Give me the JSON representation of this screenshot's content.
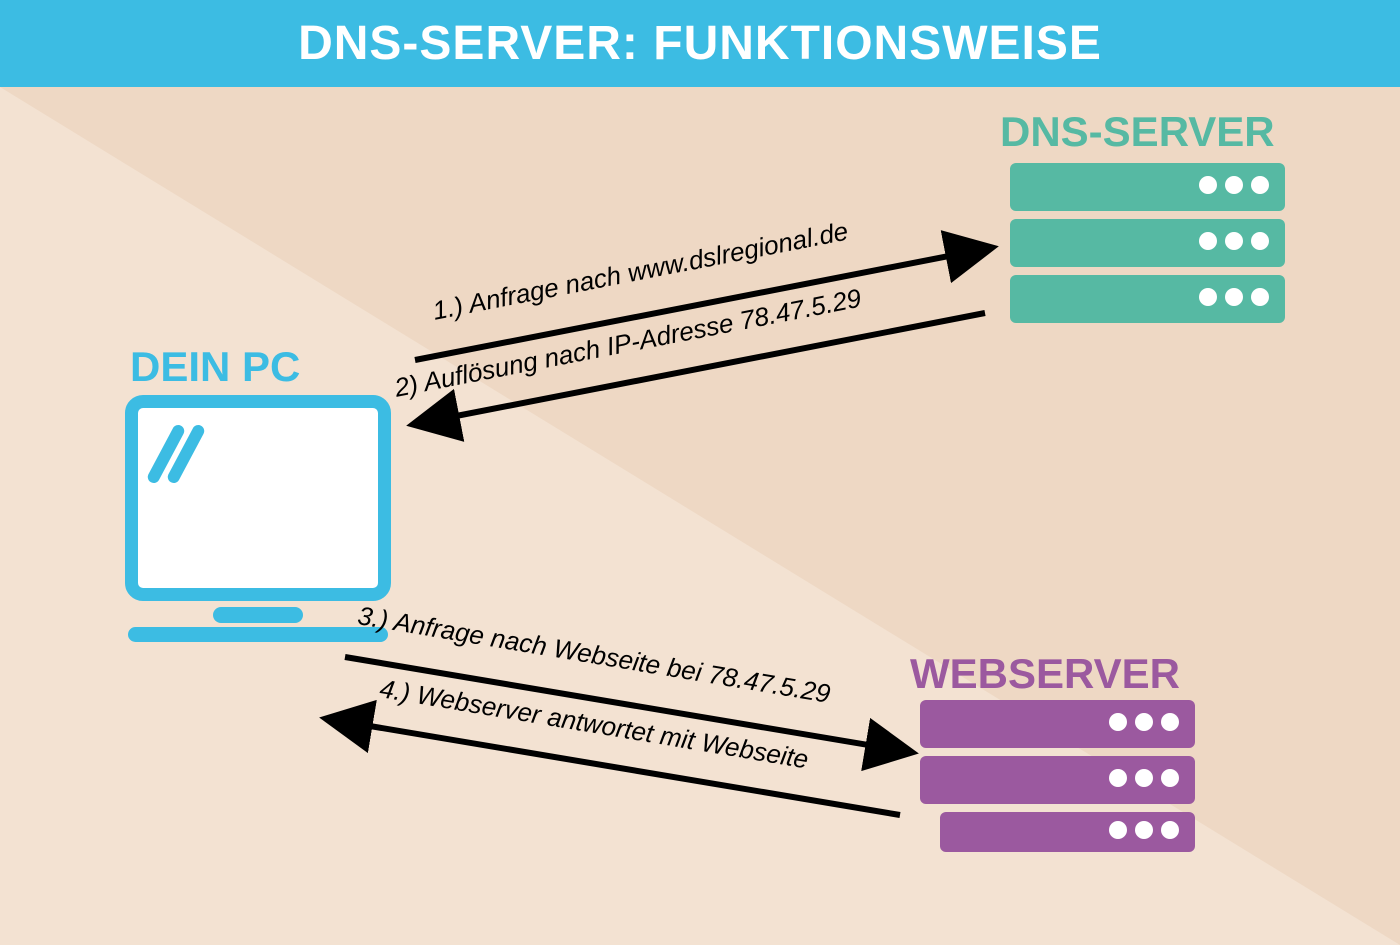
{
  "header": {
    "title": "DNS-SERVER: FUNKTIONSWEISE"
  },
  "nodes": {
    "pc": {
      "label": "DEIN PC"
    },
    "dns": {
      "label": "DNS-SERVER"
    },
    "web": {
      "label": "WEBSERVER"
    }
  },
  "steps": {
    "s1": "1.) Anfrage nach www.dslregional.de",
    "s2": "2) Auflösung nach IP-Adresse 78.47.5.29",
    "s3": "3.) Anfrage nach Webseite bei 78.47.5.29",
    "s4": "4.) Webserver antwortet mit Webseite"
  },
  "colors": {
    "header": "#3cbce3",
    "pc": "#3cbce3",
    "dns": "#56b9a3",
    "web": "#9b599f",
    "bg_light": "#f3e2d2",
    "bg_dark": "#eed8c4"
  }
}
